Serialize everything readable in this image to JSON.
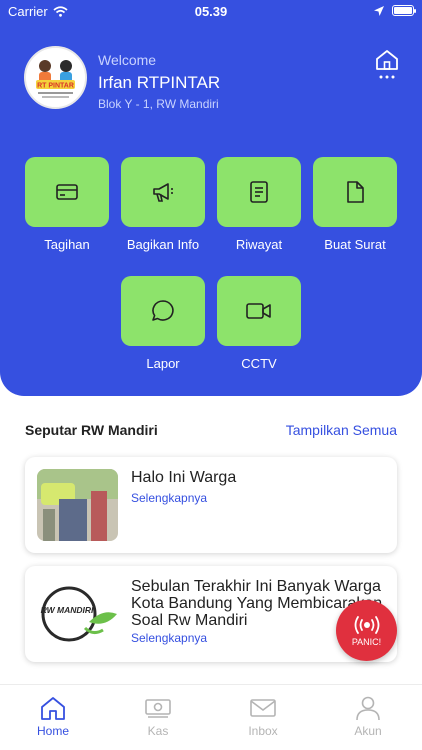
{
  "status_bar": {
    "carrier": "Carrier",
    "time": "05.39"
  },
  "header": {
    "welcome": "Welcome",
    "user_name": "Irfan RTPINTAR",
    "address": "Blok Y - 1, RW Mandiri",
    "avatar_logo_text": "RT PINTAR"
  },
  "menu": [
    {
      "label": "Tagihan",
      "icon": "card-icon"
    },
    {
      "label": "Bagikan Info",
      "icon": "megaphone-icon"
    },
    {
      "label": "Riwayat",
      "icon": "document-list-icon"
    },
    {
      "label": "Buat Surat",
      "icon": "file-icon"
    },
    {
      "label": "Lapor",
      "icon": "chat-bubble-icon"
    },
    {
      "label": "CCTV",
      "icon": "video-camera-icon"
    }
  ],
  "news_section": {
    "title": "Seputar RW Mandiri",
    "show_all": "Tampilkan Semua"
  },
  "news": [
    {
      "title": "Halo Ini Warga",
      "link": "Selengkapnya"
    },
    {
      "title": "Sebulan Terakhir Ini Banyak Warga Kota Bandung Yang Membicarakan Soal Rw Mandiri",
      "link": "Selengkapnya",
      "logo_text": "RW MANDIRI"
    }
  ],
  "panic": {
    "label": "PANIC!"
  },
  "tabs": [
    {
      "label": "Home",
      "icon": "home-icon",
      "active": true
    },
    {
      "label": "Kas",
      "icon": "cash-icon",
      "active": false
    },
    {
      "label": "Inbox",
      "icon": "mail-icon",
      "active": false
    },
    {
      "label": "Akun",
      "icon": "user-icon",
      "active": false
    }
  ],
  "colors": {
    "primary": "#3650e0",
    "menu_tile": "#8de36b",
    "panic": "#e0303e",
    "tab_inactive": "#b4b4b4"
  }
}
